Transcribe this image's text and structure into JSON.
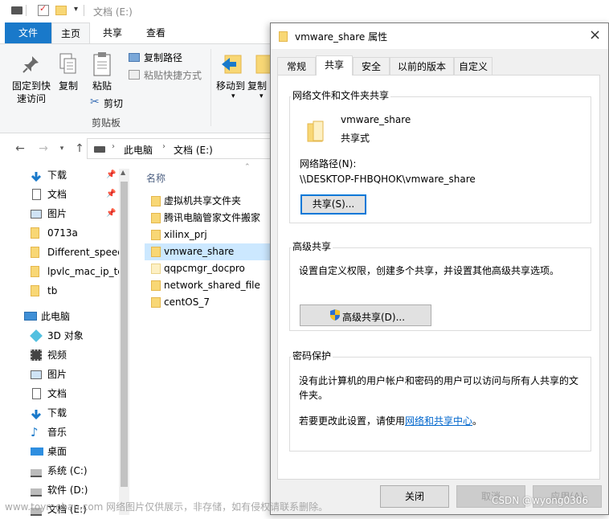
{
  "explorer": {
    "title": "文档 (E:)",
    "ribbon_tabs": [
      "文件",
      "主页",
      "共享",
      "查看"
    ],
    "ribbon": {
      "pin_quick_access": "固定到快\n速访问",
      "copy": "复制",
      "paste": "粘贴",
      "copy_path": "复制路径",
      "paste_shortcut": "粘贴快捷方式",
      "cut": "剪切",
      "clipboard_group": "剪贴板",
      "move_to": "移动到",
      "copy_to": "复制"
    },
    "breadcrumb": [
      "此电脑",
      "文档 (E:)"
    ],
    "column_header": "名称",
    "nav_items": [
      {
        "label": "下载",
        "icon": "download-icon",
        "pinned": true
      },
      {
        "label": "文档",
        "icon": "document-icon",
        "pinned": true
      },
      {
        "label": "图片",
        "icon": "picture-icon",
        "pinned": true
      },
      {
        "label": "0713a",
        "icon": "folder-icon",
        "pinned": false
      },
      {
        "label": "Different_speed",
        "icon": "folder-icon",
        "pinned": false
      },
      {
        "label": "lpvlc_mac_ip_te",
        "icon": "folder-icon",
        "pinned": false
      },
      {
        "label": "tb",
        "icon": "folder-icon",
        "pinned": false
      }
    ],
    "this_pc": "此电脑",
    "pc_items": [
      {
        "label": "3D 对象",
        "icon": "cube-icon"
      },
      {
        "label": "视频",
        "icon": "video-icon"
      },
      {
        "label": "图片",
        "icon": "picture-icon"
      },
      {
        "label": "文档",
        "icon": "document-icon"
      },
      {
        "label": "下载",
        "icon": "download-icon"
      },
      {
        "label": "音乐",
        "icon": "music-icon"
      },
      {
        "label": "桌面",
        "icon": "desktop-icon"
      },
      {
        "label": "系统 (C:)",
        "icon": "drive-icon"
      },
      {
        "label": "软件 (D:)",
        "icon": "drive-icon"
      },
      {
        "label": "文档 (E:)",
        "icon": "drive-icon"
      }
    ],
    "files": [
      {
        "name": "虚拟机共享文件夹",
        "selected": false
      },
      {
        "name": "腾讯电脑管家文件搬家",
        "selected": false
      },
      {
        "name": "xilinx_prj",
        "selected": false
      },
      {
        "name": "vmware_share",
        "selected": true
      },
      {
        "name": "qqpcmgr_docpro",
        "selected": false
      },
      {
        "name": "network_shared_file",
        "selected": false
      },
      {
        "name": "centOS_7",
        "selected": false
      }
    ]
  },
  "dialog": {
    "title": "vmware_share 属性",
    "tabs": [
      "常规",
      "共享",
      "安全",
      "以前的版本",
      "自定义"
    ],
    "active_tab": "共享",
    "net_share_group": "网络文件和文件夹共享",
    "folder_name": "vmware_share",
    "share_state": "共享式",
    "network_path_label": "网络路径(N):",
    "network_path": "\\\\DESKTOP-FHBQHOK\\vmware_share",
    "share_button": "共享(S)...",
    "advanced_group": "高级共享",
    "advanced_desc": "设置自定义权限，创建多个共享，并设置其他高级共享选项。",
    "advanced_button": "高级共享(D)...",
    "password_group": "密码保护",
    "password_desc": "没有此计算机的用户帐户和密码的用户可以访问与所有人共享的文件夹。",
    "password_change_prefix": "若要更改此设置，请使用",
    "password_link": "网络和共享中心",
    "password_change_suffix": "。",
    "close_button": "关闭",
    "cancel_button": "取消",
    "apply_button": "应用(A)"
  },
  "watermark": {
    "left": "www.toymoban.com 网络图片仅供展示，非存储，如有侵权请联系删除。",
    "right": "CSDN @wyong0306"
  },
  "colors": {
    "accent": "#1979ca",
    "selection": "#cce8ff",
    "link": "#0066cc",
    "folder": "#f8d775"
  }
}
